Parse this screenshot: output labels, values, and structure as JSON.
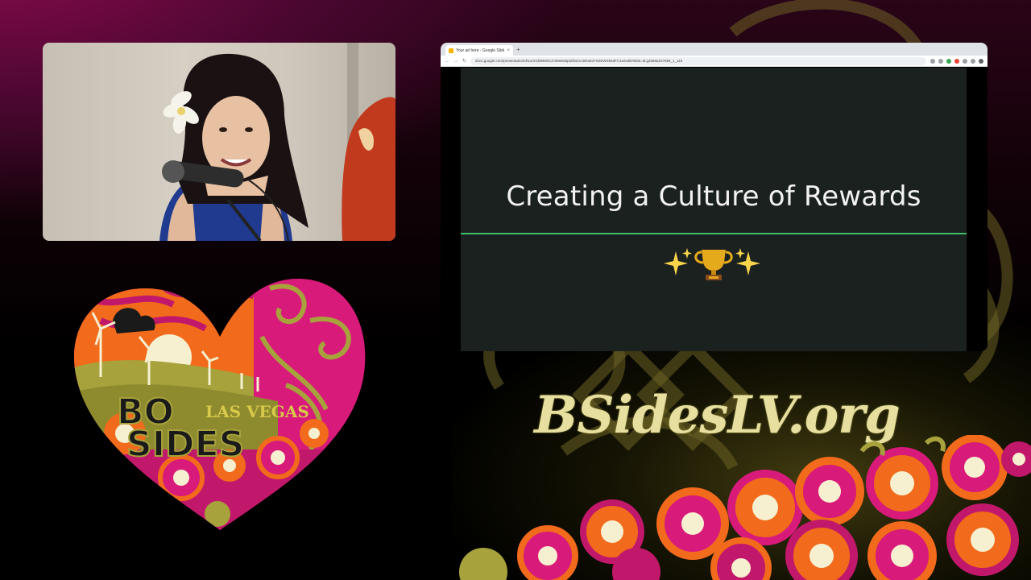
{
  "browser": {
    "tab_title": "Your ad here - Google Slides",
    "tab_close": "×",
    "new_tab": "+",
    "url": "docs.google.com/presentation/d/1uAHd39IMGUC9608vBpt2fD2rcn6RaEzFeSEWS94dFC1w/edit#slide=id.g2588a187695_1_115",
    "nav_back": "←",
    "nav_forward": "→",
    "nav_reload": "↻"
  },
  "slide": {
    "title": "Creating a Culture of Rewards",
    "emoji": "✨🏆✨"
  },
  "logo": {
    "line1": "BO",
    "line2": "SIDES",
    "subtitle": "LAS VEGAS"
  },
  "site_url": "BSidesLV.org",
  "colors": {
    "slide_bg": "#1b211f",
    "slide_rule": "#3fbf6a",
    "brand_gold": "#e6dfa0",
    "brand_magenta": "#c2186b",
    "brand_orange": "#f26a1b"
  }
}
